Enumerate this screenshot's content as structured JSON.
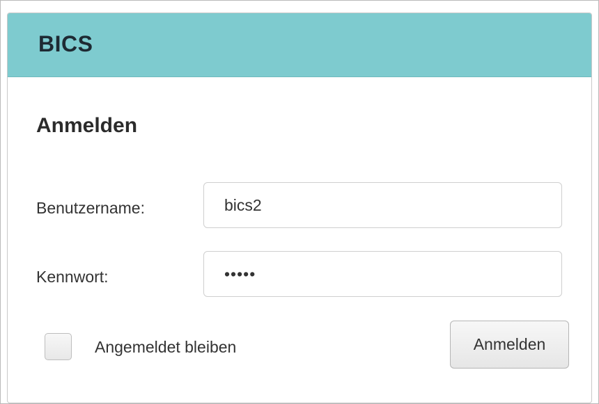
{
  "app": {
    "title": "BICS"
  },
  "form": {
    "heading": "Anmelden",
    "username": {
      "label": "Benutzername:",
      "value": "bics2"
    },
    "password": {
      "label": "Kennwort:",
      "value": "•••••"
    },
    "remember": {
      "label": "Angemeldet bleiben",
      "checked": false
    },
    "submit_label": "Anmelden"
  },
  "colors": {
    "header_background": "#7ecbcf",
    "title_text": "#1e2a33"
  }
}
